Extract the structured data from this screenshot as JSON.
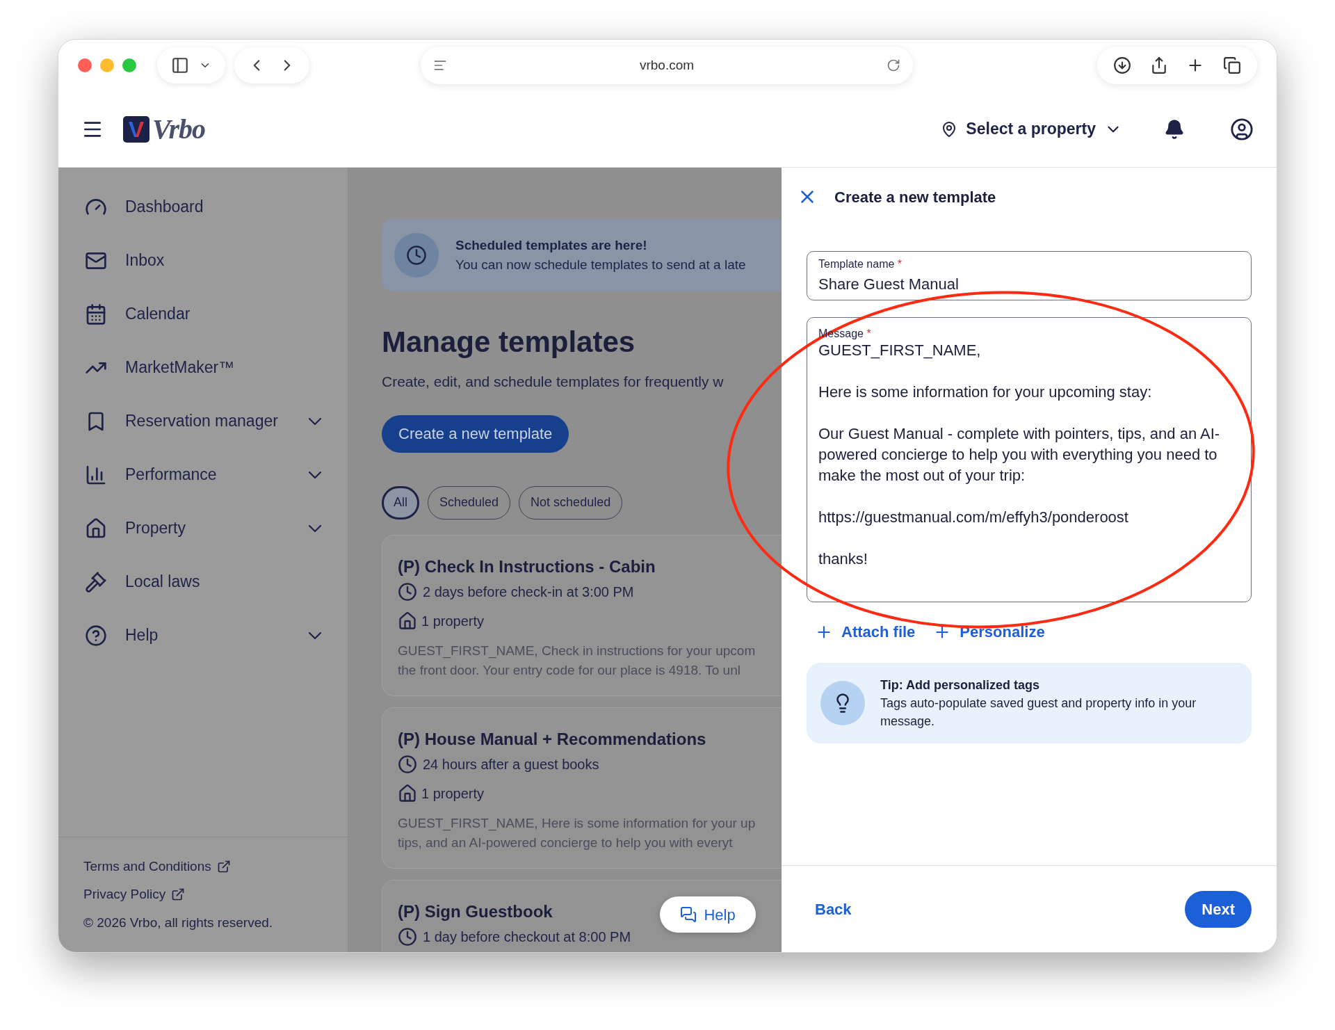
{
  "browser": {
    "url": "vrbo.com"
  },
  "header": {
    "logo": "Vrbo",
    "property_selector": "Select a property"
  },
  "sidebar": {
    "items": [
      {
        "label": "Dashboard",
        "expandable": false
      },
      {
        "label": "Inbox",
        "expandable": false
      },
      {
        "label": "Calendar",
        "expandable": false
      },
      {
        "label": "MarketMaker™",
        "expandable": false
      },
      {
        "label": "Reservation manager",
        "expandable": true
      },
      {
        "label": "Performance",
        "expandable": true
      },
      {
        "label": "Property",
        "expandable": true
      },
      {
        "label": "Local laws",
        "expandable": false
      },
      {
        "label": "Help",
        "expandable": true
      }
    ],
    "footer_links": [
      "Terms and Conditions",
      "Privacy Policy"
    ],
    "copyright": "© 2026 Vrbo, all rights reserved."
  },
  "main": {
    "banner": {
      "title": "Scheduled templates are here!",
      "text": "You can now schedule templates to send at a late"
    },
    "heading": "Manage templates",
    "subtitle": "Create, edit, and schedule templates for frequently w",
    "create_button": "Create a new template",
    "filters": [
      {
        "label": "All",
        "selected": true
      },
      {
        "label": "Scheduled",
        "selected": false
      },
      {
        "label": "Not scheduled",
        "selected": false
      }
    ],
    "templates": [
      {
        "title": "(P) Check In Instructions - Cabin",
        "schedule": "2 days before check-in at 3:00 PM",
        "properties": "1 property",
        "preview": [
          "GUEST_FIRST_NAME, Check in instructions for your upcom",
          "the front door. Your entry code for our place is 4918. To unl"
        ]
      },
      {
        "title": "(P) House Manual + Recommendations",
        "schedule": "24 hours after a guest books",
        "properties": "1 property",
        "preview": [
          "GUEST_FIRST_NAME, Here is some information for your up",
          "tips, and an AI-powered concierge to help you with everyt"
        ]
      },
      {
        "title": "(P) Sign Guestbook",
        "schedule": "1 day before checkout at 8:00 PM"
      }
    ]
  },
  "help_button": "Help",
  "panel": {
    "title": "Create a new template",
    "name_field": {
      "label": "Template name",
      "required_mark": "*",
      "value": "Share Guest Manual"
    },
    "message_field": {
      "label": "Message",
      "required_mark": "*",
      "value": "GUEST_FIRST_NAME,\n\nHere is some information for your upcoming stay:\n\nOur Guest Manual - complete with pointers, tips, and an AI-powered concierge to help you with everything you need to make the most out of your trip:\n\nhttps://guestmanual.com/m/effyh3/ponderoost\n\nthanks!"
    },
    "actions": [
      "Attach file",
      "Personalize"
    ],
    "tip": {
      "title": "Tip: Add personalized tags",
      "text": "Tags auto-populate saved guest and property info in your message."
    },
    "back": "Back",
    "next": "Next"
  }
}
